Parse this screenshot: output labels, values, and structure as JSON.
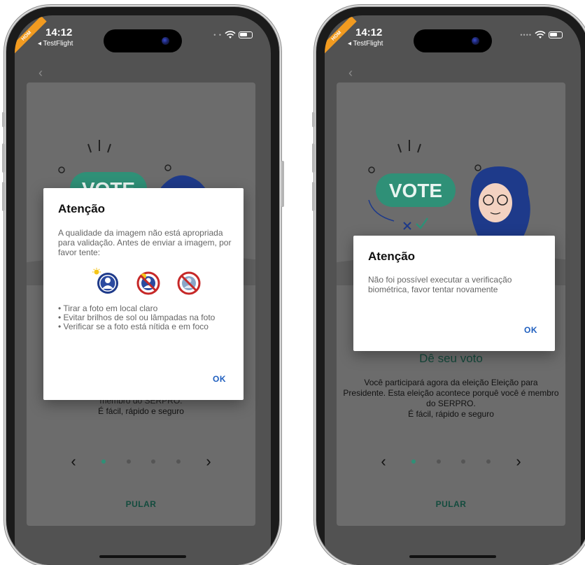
{
  "status": {
    "time": "14:12",
    "app": "◂ TestFlight",
    "ribbon": "HOM"
  },
  "onboarding": {
    "title": "Dê seu voto",
    "description": "Você participará agora da eleição Eleição para Presidente. Esta eleição acontece porquê você é membro do SERPRO.",
    "tagline": "É fácil, rápido e seguro",
    "skip_label": "PULAR",
    "prev_arrow": "‹",
    "next_arrow": "›",
    "illustration_text": "VOTE"
  },
  "dialog_quality": {
    "title": "Atenção",
    "message": "A qualidade da imagem não está apropriada para validação. Antes de enviar a imagem, por favor tente:",
    "tips": [
      "• Tirar a foto em local claro",
      "• Evitar brilhos de sol ou lâmpadas na foto",
      "• Verificar se a foto está nítida e em foco"
    ],
    "ok_label": "OK"
  },
  "dialog_biometric": {
    "title": "Atenção",
    "message": "Não foi possível executar a verificação biométrica, favor tentar novamente",
    "ok_label": "OK"
  },
  "colors": {
    "accent_green": "#2f9077",
    "title_green": "#15473a",
    "ok_blue": "#1f5fbf",
    "prohibit_red": "#c62828",
    "illustration_blue": "#1e3a8a"
  }
}
